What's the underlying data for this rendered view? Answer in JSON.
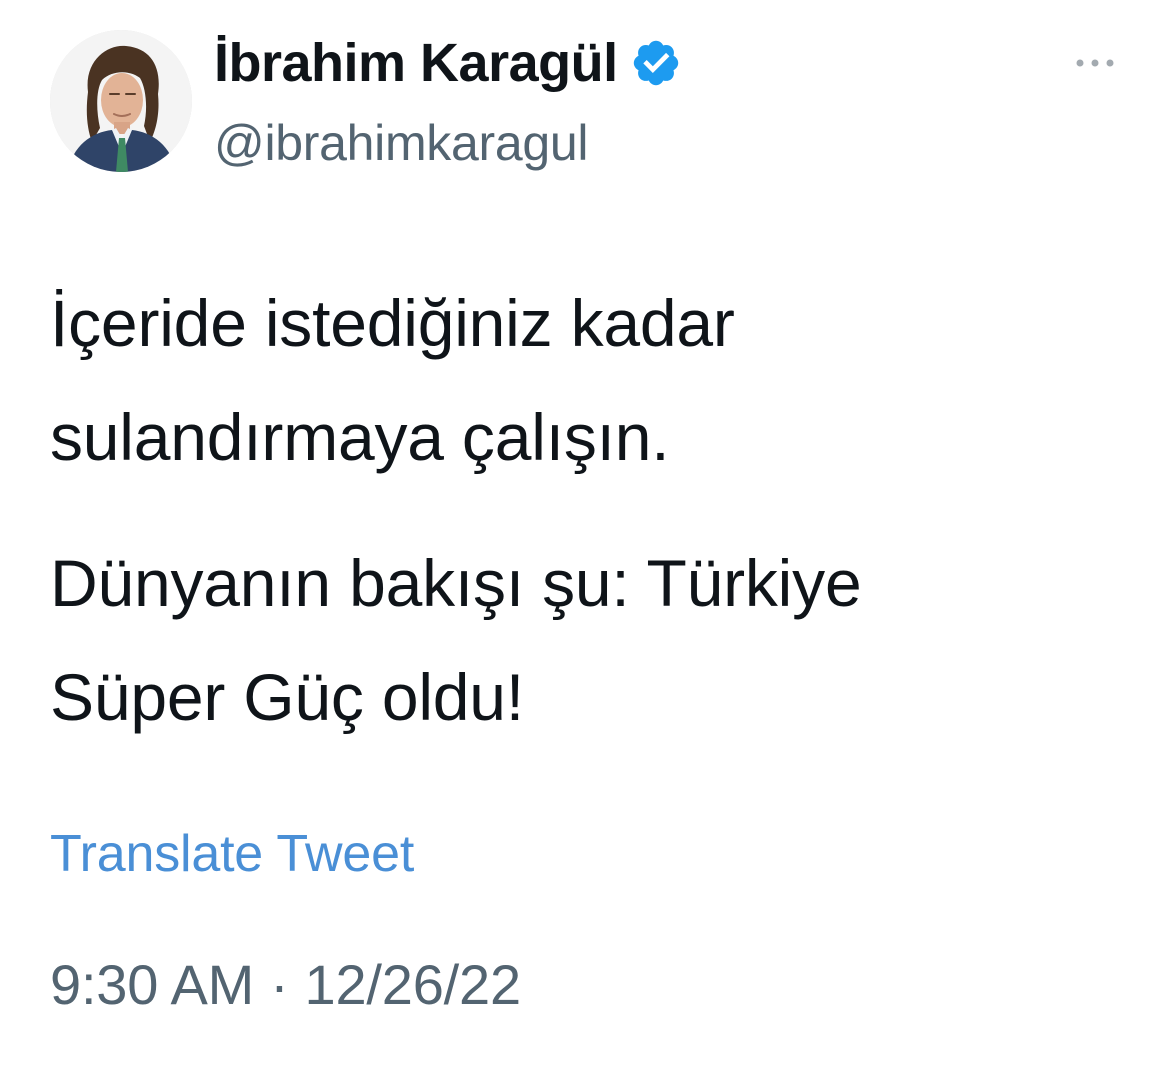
{
  "author": {
    "display_name": "İbrahim Karagül",
    "handle": "@ibrahimkaragul",
    "verified": true,
    "verified_color": "#1d9bf0"
  },
  "tweet": {
    "paragraphs": [
      {
        "lines": [
          "İçeride istediğiniz kadar",
          "sulandırmaya çalışın."
        ]
      },
      {
        "lines": [
          "Dünyanın bakışı şu: Türkiye",
          "Süper Güç oldu!"
        ]
      }
    ]
  },
  "translate_label": "Translate Tweet",
  "timestamp": {
    "time": "9:30 AM",
    "separator": "·",
    "date": "12/26/22"
  },
  "icons": {
    "more": "more-horizontal-icon",
    "verified": "verified-badge-icon"
  },
  "colors": {
    "text": "#0f1419",
    "secondary": "#536471",
    "link": "#4a8fd6"
  }
}
